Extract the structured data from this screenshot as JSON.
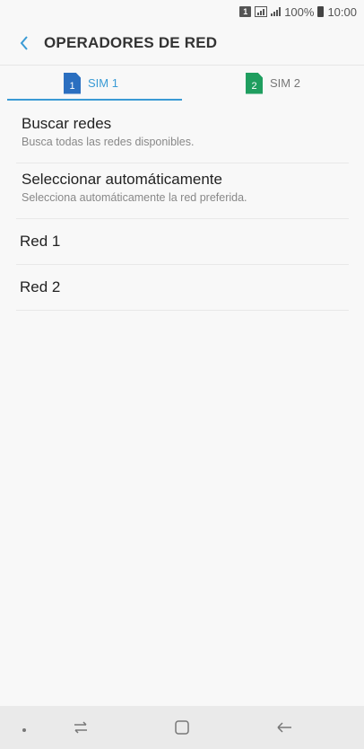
{
  "status_bar": {
    "sim_badge": "1",
    "battery": "100%",
    "time": "10:00"
  },
  "header": {
    "title": "OPERADORES DE RED",
    "back_icon": "chevron-left-icon"
  },
  "tabs": [
    {
      "label": "SIM 1",
      "sim_number": "1",
      "icon_color": "#2b6fc0",
      "active": true
    },
    {
      "label": "SIM 2",
      "sim_number": "2",
      "icon_color": "#1f9e5f",
      "active": false
    }
  ],
  "list": {
    "search_networks": {
      "title": "Buscar redes",
      "subtitle": "Busca todas las redes disponibles."
    },
    "auto_select": {
      "title": "Seleccionar automáticamente",
      "subtitle": "Selecciona automáticamente la red preferida."
    },
    "networks": [
      "Red 1",
      "Red 2"
    ]
  },
  "colors": {
    "accent": "#3a9bd5",
    "background": "#f8f8f8"
  },
  "nav_bar": {
    "icons": [
      "dot-icon",
      "recents-icon",
      "home-icon",
      "back-icon"
    ]
  }
}
